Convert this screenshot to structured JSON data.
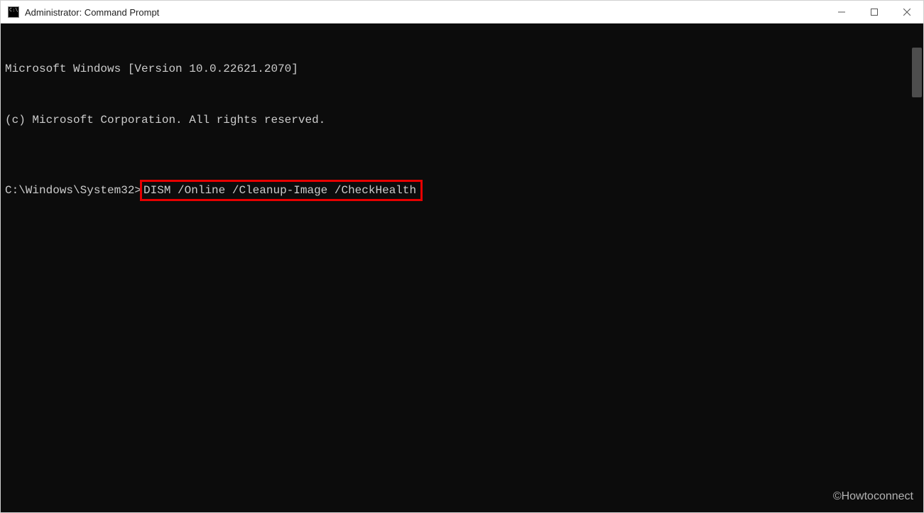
{
  "titlebar": {
    "title": "Administrator: Command Prompt"
  },
  "terminal": {
    "line1": "Microsoft Windows [Version 10.0.22621.2070]",
    "line2": "(c) Microsoft Corporation. All rights reserved.",
    "prompt": "C:\\Windows\\System32>",
    "command": "DISM /Online /Cleanup-Image /CheckHealth"
  },
  "watermark": "©Howtoconnect"
}
